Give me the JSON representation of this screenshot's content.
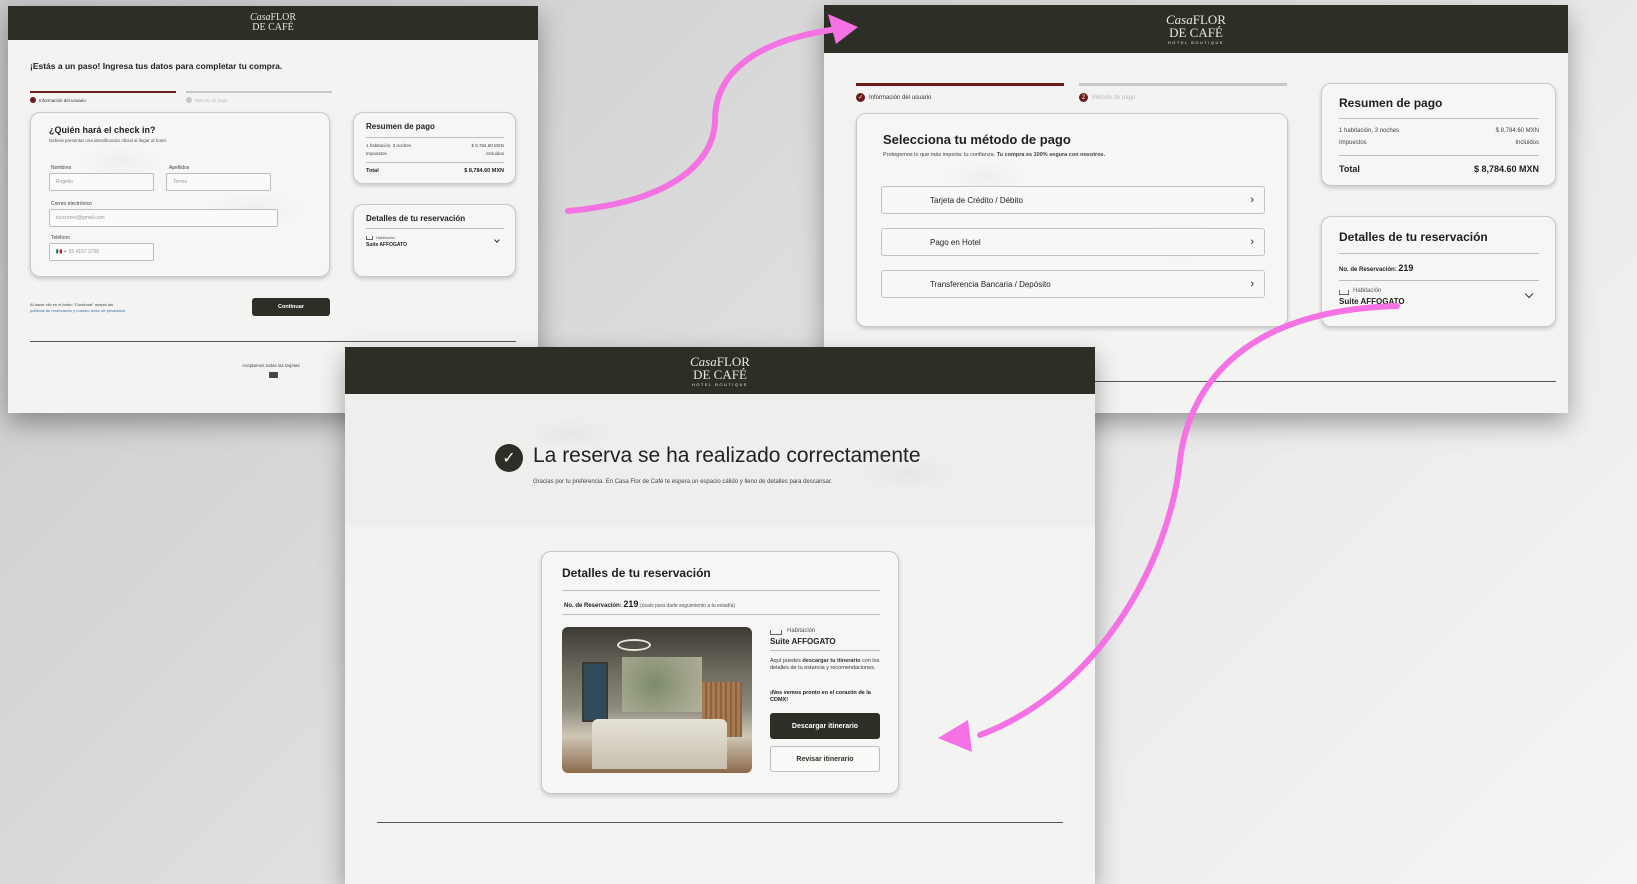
{
  "brand": {
    "casa": "Casa",
    "name_line1": "FLOR",
    "name_line2": "DE CAFÉ",
    "tagline": "HOTEL BOUTIQUE"
  },
  "colors": {
    "header": "#2d2f27",
    "accent_red": "#6b1d1d",
    "arrow": "#f472e3"
  },
  "screen1": {
    "heading": "¡Estás a un paso! Ingresa tus datos para completar tu compra.",
    "step1": "Información del usuario",
    "step2": "Método de pago",
    "form": {
      "title": "¿Quién hará el check in?",
      "subtitle": "Deberá presentar una identificación oficial al llegar al hotel.",
      "name_label": "Nombres",
      "name_value": "Rogelio",
      "lastname_label": "Apellidos",
      "lastname_value": "Torres",
      "email_label": "Correo electrónico",
      "email_value": "tuscorreo@gmail.com",
      "phone_label": "Teléfono",
      "phone_prefix": "🇲🇽 +",
      "phone_value": "55 4157 3790"
    },
    "summary": {
      "title": "Resumen de pago",
      "line1_label": "1 habitación, 3 noches",
      "line1_value": "$ 8,784.60 MXN",
      "line2_label": "Impuestos",
      "line2_value": "Incluidos",
      "total_label": "Total",
      "total_value": "$ 8,784.60 MXN"
    },
    "details": {
      "title": "Detalles de tu reservación",
      "room_label": "Habitación",
      "room_name": "Suite AFFOGATO"
    },
    "legal_text": "Al hacer clic en el botón \"Continuar\" acepto las",
    "legal_link": "políticas de reservación y nuestro aviso de privacidad",
    "continue_button": "Continuar",
    "footer_cards": "Aceptamos todas las tarjetas"
  },
  "screen2": {
    "step1": "Información del usuario",
    "step2": "Método de pago",
    "title": "Selecciona tu método de pago",
    "subtitle_plain": "Protegemos lo que más importa: tu confianza.",
    "subtitle_bold": "Tu compra es 100% segura con nosotros.",
    "options": [
      "Tarjeta de Crédito / Débito",
      "Pago en Hotel",
      "Transferencia Bancaria / Depósito"
    ],
    "summary": {
      "title": "Resumen de pago",
      "line1_label": "1 habitación, 3 noches",
      "line1_value": "$ 8,784.60 MXN",
      "line2_label": "Impuestos",
      "line2_value": "Incluidos",
      "total_label": "Total",
      "total_value": "$ 8,784.60 MXN"
    },
    "details": {
      "title": "Detalles de tu reservación",
      "res_label": "No. de Reservación:",
      "res_number": "219",
      "room_label": "Habitación",
      "room_name": "Suite AFFOGATO"
    }
  },
  "screen3": {
    "title": "La reserva se ha realizado correctamente",
    "subtitle": "Gracias por tu preferencia. En Casa Flor de Café te espera un espacio cálido y lleno de detalles para descansar.",
    "card": {
      "title": "Detalles de tu reservación",
      "res_label": "No. de Reservación:",
      "res_number": "219",
      "res_hint": "(úsalo para darle seguimiento a tu estadía)",
      "room_label": "Habitación",
      "room_name": "Suite AFFOGATO",
      "desc_pre": "Aquí puedes",
      "desc_bold": "descargar tu itinerario",
      "desc_post": "con los detalles de tu estancia y recomendaciones.",
      "farewell": "¡Nos vemos pronto en el corazón de la CDMX!",
      "download_button": "Descargar itinerario",
      "review_button": "Revisar itinerario"
    }
  }
}
